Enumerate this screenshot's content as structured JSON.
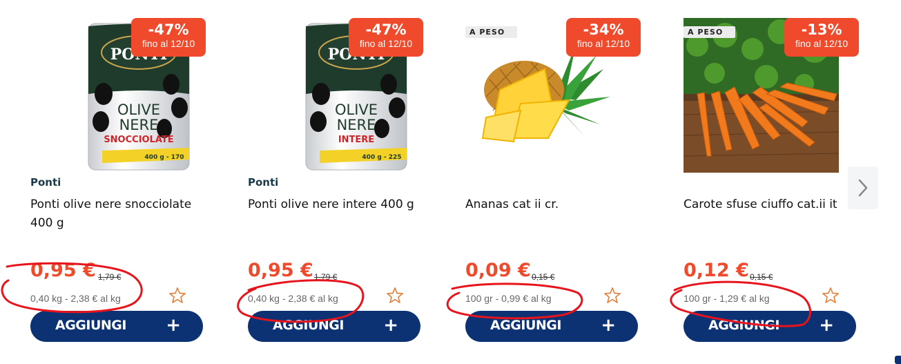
{
  "products": [
    {
      "discount": "-47%",
      "until": "fino al 12/10",
      "weight_tag": "",
      "brand": "Ponti",
      "name": "Ponti olive nere snocciolate 400 g",
      "price": "0,95 €",
      "old_price": "1,79 €",
      "unit_info": "0,40 kg -  2,38 € al kg",
      "add_label": "AGGIUNGI",
      "image": "olive-can-icon",
      "can_label": {
        "est": "1787",
        "logo": "PONTI",
        "line1": "OLIVE",
        "line2": "NERE",
        "line3": "SNOCCIOLATE",
        "weight": "400 g - 170"
      }
    },
    {
      "discount": "-47%",
      "until": "fino al 12/10",
      "weight_tag": "",
      "brand": "Ponti",
      "name": "Ponti olive nere intere 400 g",
      "price": "0,95 €",
      "old_price": "1,79 €",
      "unit_info": "0,40 kg -  2,38 € al kg",
      "add_label": "AGGIUNGI",
      "image": "olive-can-icon",
      "can_label": {
        "est": "1787",
        "logo": "PONTI",
        "line1": "OLIVE",
        "line2": "NERE",
        "line3": "INTERE",
        "weight": "400 g - 225"
      }
    },
    {
      "discount": "-34%",
      "until": "fino al 12/10",
      "weight_tag": "A PESO",
      "brand": "",
      "name": "Ananas cat ii cr.",
      "price": "0,09 €",
      "old_price": "0,15 €",
      "unit_info": "100 gr -  0,99 € al kg",
      "add_label": "AGGIUNGI",
      "image": "pineapple-icon"
    },
    {
      "discount": "-13%",
      "until": "fino al 12/10",
      "weight_tag": "A PESO",
      "brand": "",
      "name": "Carote sfuse ciuffo cat.ii it",
      "price": "0,12 €",
      "old_price": "0,15 €",
      "unit_info": "100 gr -  1,29 € al kg",
      "add_label": "AGGIUNGI",
      "image": "carrots-icon"
    }
  ],
  "add_plus": "+",
  "colors": {
    "accent": "#f04a2d",
    "button": "#0c3273",
    "brand_text": "#1a3a4a",
    "annotation": "#e8141c"
  },
  "icons": {
    "favorite": "star-outline-icon",
    "next": "chevron-right-icon"
  }
}
